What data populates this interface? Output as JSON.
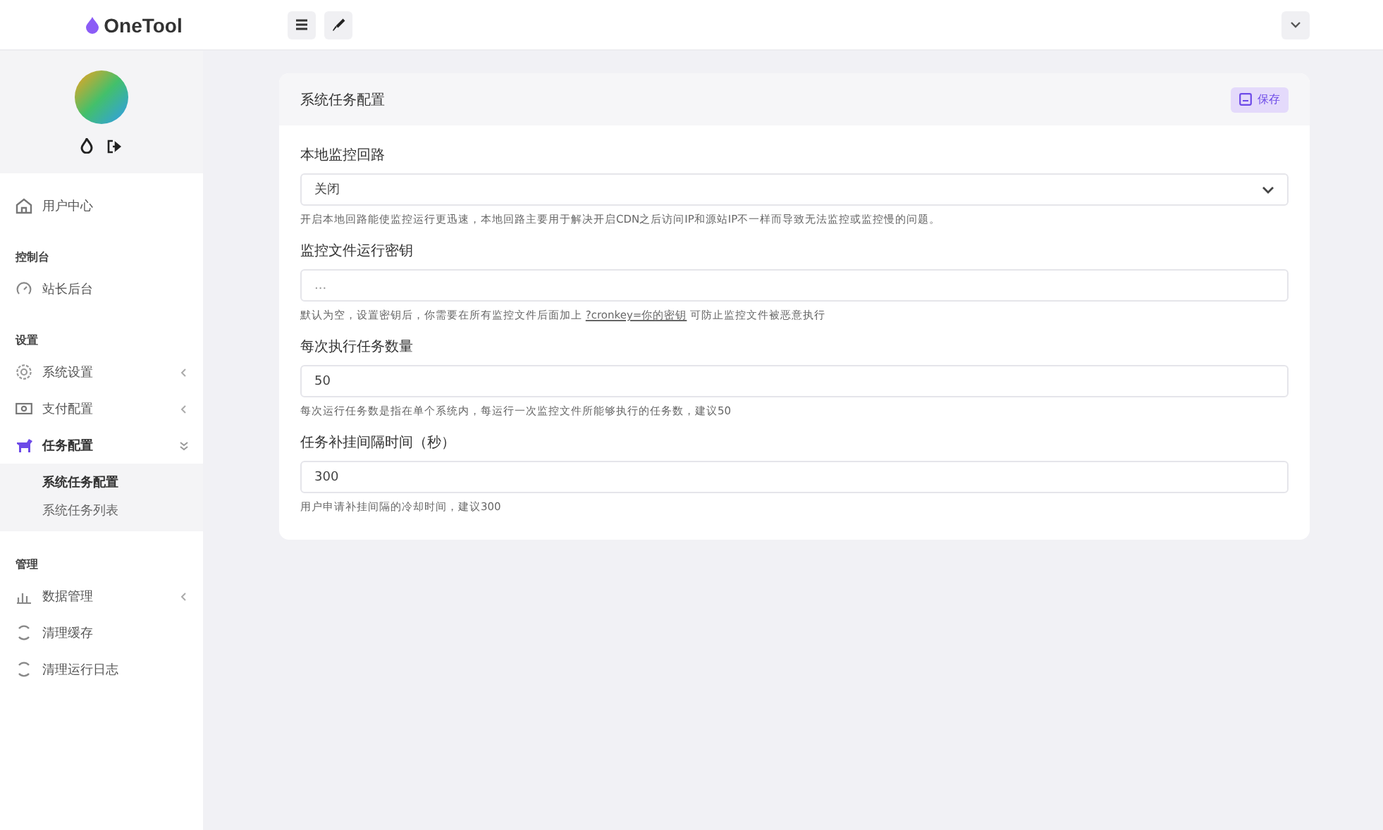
{
  "brand": {
    "name": "OneTool"
  },
  "sidebar": {
    "groups": [
      {
        "items": [
          {
            "label": "用户中心",
            "selected": false
          }
        ]
      },
      {
        "heading": "控制台",
        "items": [
          {
            "label": "站长后台",
            "selected": false
          }
        ]
      },
      {
        "heading": "设置",
        "items": [
          {
            "label": "系统设置",
            "selected": false,
            "expanded": false
          },
          {
            "label": "支付配置",
            "selected": false,
            "expanded": false
          },
          {
            "label": "任务配置",
            "selected": true,
            "expanded": true,
            "children": [
              {
                "label": "系统任务配置",
                "selected": true
              },
              {
                "label": "系统任务列表",
                "selected": false
              }
            ]
          }
        ]
      },
      {
        "heading": "管理",
        "items": [
          {
            "label": "数据管理",
            "selected": false,
            "expanded": false
          },
          {
            "label": "清理缓存",
            "selected": false
          },
          {
            "label": "清理运行日志",
            "selected": false
          }
        ]
      }
    ]
  },
  "card": {
    "title": "系统任务配置",
    "save_button": "保存",
    "fields": [
      {
        "kind": "select",
        "label": "本地监控回路",
        "value": "关闭",
        "help": [
          {
            "text": "开启本地回路能使监控运行更迅速，本地回路主要用于解决开启CDN之后访问IP和源站IP不一样而导致无法监控或监控慢的问题。"
          }
        ]
      },
      {
        "kind": "input",
        "label": "监控文件运行密钥",
        "placeholder": "...",
        "help": [
          {
            "text": "默认为空，设置密钥后，你需要在所有监控文件后面加上 "
          },
          {
            "text": "?cronkey=你的密钥",
            "link": true
          },
          {
            "text": " 可防止监控文件被恶意执行"
          }
        ]
      },
      {
        "kind": "input",
        "label": "每次执行任务数量",
        "value": "50",
        "help": [
          {
            "text": "每次运行任务数是指在单个系统内，每运行一次监控文件所能够执行的任务数，建议50"
          }
        ]
      },
      {
        "kind": "input",
        "label": "任务补挂间隔时间（秒）",
        "value": "300",
        "help": [
          {
            "text": "用户申请补挂间隔的冷却时间，建议300"
          }
        ]
      }
    ]
  }
}
